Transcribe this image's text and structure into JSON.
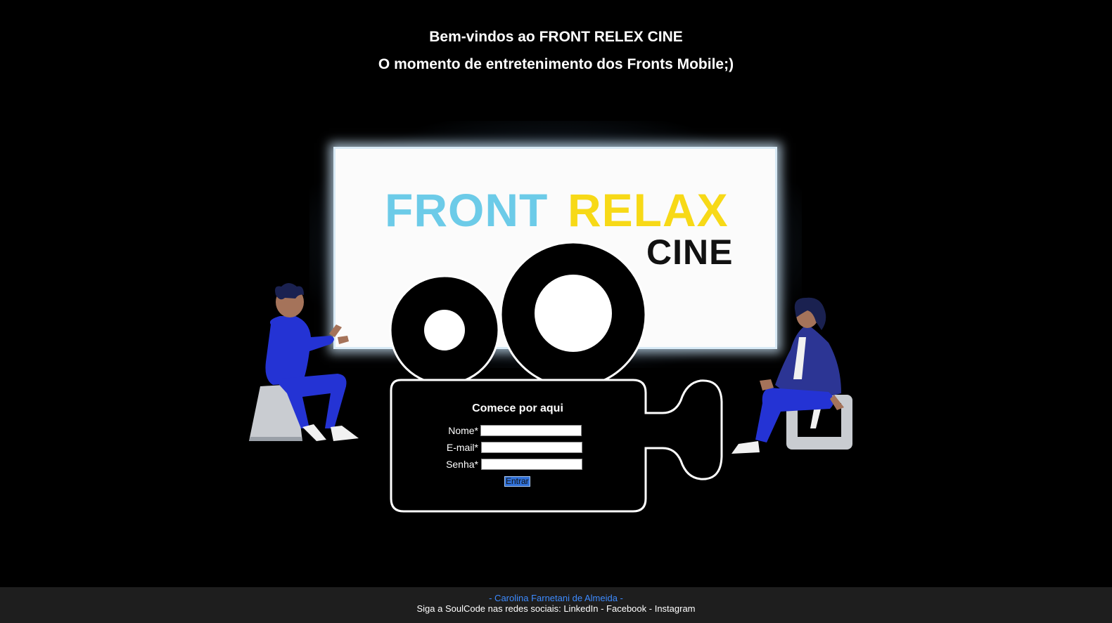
{
  "header": {
    "welcome": "Bem-vindos ao FRONT RELEX CINE",
    "tagline": "O momento de entretenimento dos Fronts Mobile;)"
  },
  "logo": {
    "front": "FRONT",
    "relax": "RELAX",
    "cine": "CINE",
    "colors": {
      "front": "#6ccbe8",
      "relax": "#f7d917",
      "cine": "#111111"
    }
  },
  "form": {
    "title": "Comece por aqui",
    "name_label": "Nome*",
    "email_label": "E-mail*",
    "password_label": "Senha*",
    "name_value": "",
    "email_value": "",
    "password_value": "",
    "submit_label": "Entrar"
  },
  "footer": {
    "author": "- Carolina Farnetani de Almeida -",
    "social_prefix": "Siga a SoulCode nas redes sociais: ",
    "linkedin": "LinkedIn",
    "sep1": " - ",
    "facebook": "Facebook",
    "sep2": " - ",
    "instagram": "Instagram"
  },
  "colors": {
    "background": "#000000",
    "footer_bg": "#1e1e1e",
    "author_link": "#3d8bff",
    "button": "#2f6fd6"
  }
}
